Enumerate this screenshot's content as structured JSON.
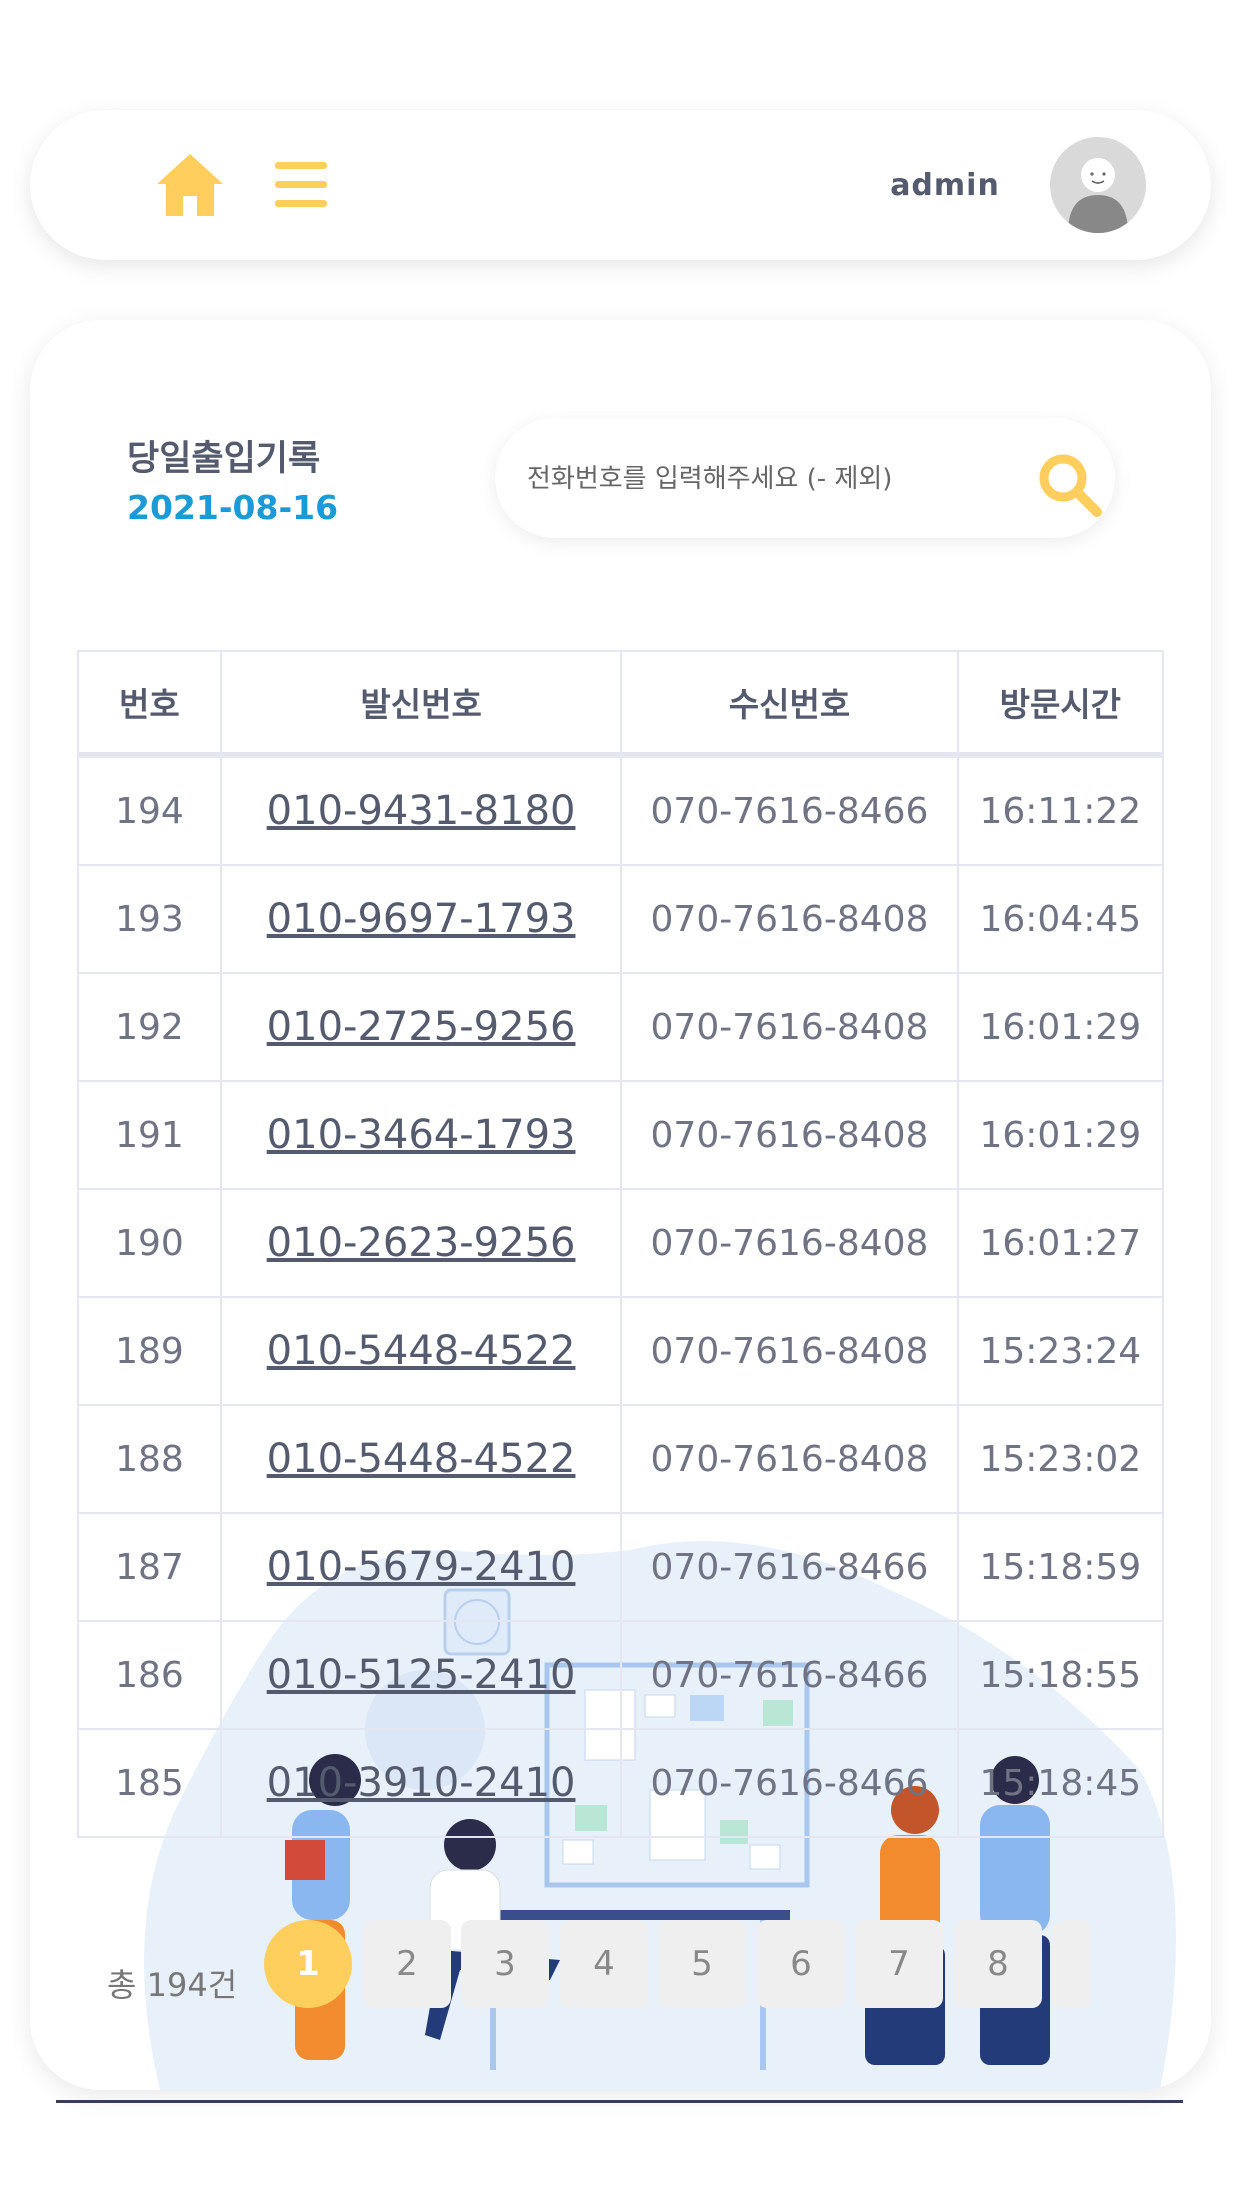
{
  "header": {
    "username": "admin",
    "icons": [
      "home-icon",
      "menu-icon",
      "avatar"
    ]
  },
  "main": {
    "title": "당일출입기록",
    "date": "2021-08-16",
    "search": {
      "placeholder": "전화번호를 입력해주세요 (- 제외)"
    }
  },
  "table": {
    "headers": [
      "번호",
      "발신번호",
      "수신번호",
      "방문시간"
    ],
    "rows": [
      {
        "num": "194",
        "caller": "010-9431-8180",
        "receiver": "070-7616-8466",
        "time": "16:11:22"
      },
      {
        "num": "193",
        "caller": "010-9697-1793",
        "receiver": "070-7616-8408",
        "time": "16:04:45"
      },
      {
        "num": "192",
        "caller": "010-2725-9256",
        "receiver": "070-7616-8408",
        "time": "16:01:29"
      },
      {
        "num": "191",
        "caller": "010-3464-1793",
        "receiver": "070-7616-8408",
        "time": "16:01:29"
      },
      {
        "num": "190",
        "caller": "010-2623-9256",
        "receiver": "070-7616-8408",
        "time": "16:01:27"
      },
      {
        "num": "189",
        "caller": "010-5448-4522",
        "receiver": "070-7616-8408",
        "time": "15:23:24"
      },
      {
        "num": "188",
        "caller": "010-5448-4522",
        "receiver": "070-7616-8408",
        "time": "15:23:02"
      },
      {
        "num": "187",
        "caller": "010-5679-2410",
        "receiver": "070-7616-8466",
        "time": "15:18:59"
      },
      {
        "num": "186",
        "caller": "010-5125-2410",
        "receiver": "070-7616-8466",
        "time": "15:18:55"
      },
      {
        "num": "185",
        "caller": "010-3910-2410",
        "receiver": "070-7616-8466",
        "time": "15:18:45"
      }
    ]
  },
  "pagination": {
    "total": "총 194건",
    "pages": [
      "1",
      "2",
      "3",
      "4",
      "5",
      "6",
      "7",
      "8"
    ],
    "current": "1"
  },
  "colors": {
    "accent": "#ffce5c",
    "date": "#1a9bd7",
    "text": "#555b6e"
  }
}
